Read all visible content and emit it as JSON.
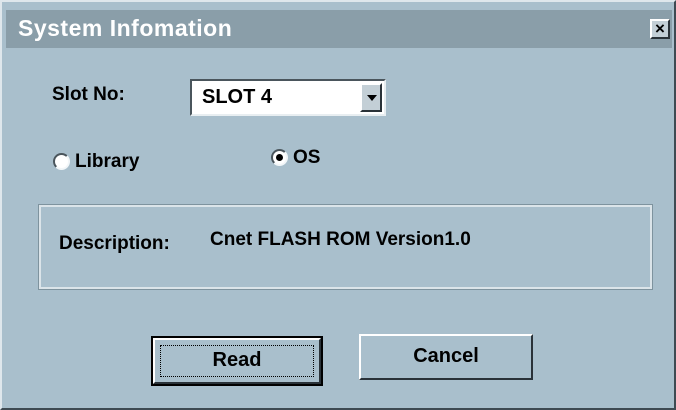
{
  "window": {
    "title": "System Infomation",
    "close_glyph": "×"
  },
  "slot": {
    "label": "Slot No:",
    "value": "SLOT 4"
  },
  "mode": {
    "options": [
      {
        "label": "Library",
        "checked": false
      },
      {
        "label": "OS",
        "checked": true
      }
    ]
  },
  "description": {
    "label": "Description:",
    "value": "Cnet FLASH ROM Version1.0"
  },
  "buttons": {
    "read": "Read",
    "cancel": "Cancel"
  },
  "colors": {
    "dialog_bg": "#a9bfcc",
    "titlebar": "#8a9ea9",
    "title_text": "#ffffff"
  }
}
